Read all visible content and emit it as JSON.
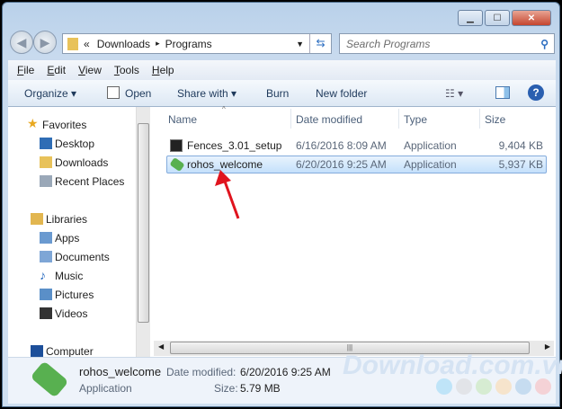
{
  "window": {
    "minimize": "▁",
    "maximize": "☐",
    "close": "✕"
  },
  "address": {
    "overflow": "«",
    "crumbs": [
      "Downloads",
      "Programs"
    ],
    "sep": "▸"
  },
  "search": {
    "placeholder": "Search Programs"
  },
  "menu": [
    "File",
    "Edit",
    "View",
    "Tools",
    "Help"
  ],
  "toolbar": {
    "organize": "Organize ▾",
    "open": "Open",
    "share": "Share with ▾",
    "burn": "Burn",
    "new_folder": "New folder"
  },
  "nav": {
    "favorites": "Favorites",
    "desktop": "Desktop",
    "downloads": "Downloads",
    "recent": "Recent Places",
    "libraries": "Libraries",
    "apps": "Apps",
    "documents": "Documents",
    "music": "Music",
    "pictures": "Pictures",
    "videos": "Videos",
    "computer": "Computer"
  },
  "columns": [
    "Name",
    "Date modified",
    "Type",
    "Size"
  ],
  "files": [
    {
      "name": "Fences_3.01_setup",
      "date": "6/16/2016 8:09 AM",
      "type": "Application",
      "size": "9,404 KB"
    },
    {
      "name": "rohos_welcome",
      "date": "6/20/2016 9:25 AM",
      "type": "Application",
      "size": "5,937 KB",
      "selected": true
    }
  ],
  "details": {
    "name": "rohos_welcome",
    "type": "Application",
    "date_label": "Date modified:",
    "date": "6/20/2016 9:25 AM",
    "size_label": "Size:",
    "size": "5.79 MB"
  },
  "watermark": "Download.com.vn",
  "colors": {
    "selection": "#c4e0fb",
    "arrow": "#e0141e",
    "accent": "#1e395b"
  }
}
